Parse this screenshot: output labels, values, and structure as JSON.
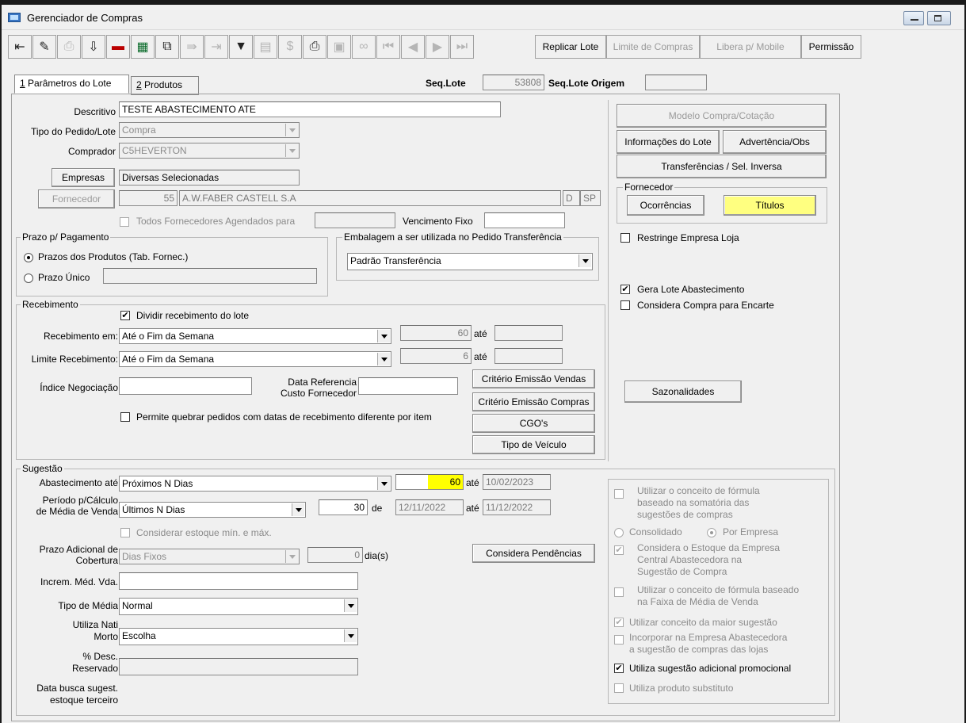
{
  "window": {
    "title": "Gerenciador de Compras"
  },
  "toolbar": {
    "icons": [
      "exit-icon",
      "edit-icon",
      "print-preview-icon",
      "download-icon",
      "delete-icon",
      "spreadsheet-icon",
      "copy-icon",
      "generate-icon",
      "forward-icon",
      "filter-icon",
      "document-icon",
      "cost-icon",
      "print-icon",
      "clipboard-icon",
      "binoculars-icon",
      "first-icon",
      "prev-icon",
      "next-icon",
      "last-icon"
    ],
    "replicar_lote": "Replicar Lote",
    "limite_compras": "Limite de Compras",
    "libera_mobile": "Libera p/ Mobile",
    "permissao": "Permissão"
  },
  "tabs": [
    {
      "num": "1",
      "label": " Parâmetros do Lote"
    },
    {
      "num": "2",
      "label": " Produtos"
    }
  ],
  "header": {
    "seq_lote_label": "Seq.Lote",
    "seq_lote": "53808",
    "seq_lote_origem_label": "Seq.Lote Origem",
    "seq_lote_origem": ""
  },
  "form": {
    "descritivo_label": "Descritivo",
    "descritivo": "TESTE ABASTECIMENTO ATE",
    "tipo_pedido_label": "Tipo do Pedido/Lote",
    "tipo_pedido": "Compra",
    "comprador_label": "Comprador",
    "comprador": "C5HEVERTON",
    "empresas_btn": "Empresas",
    "empresas": "Diversas Selecionadas",
    "fornecedor_btn": "Fornecedor",
    "fornecedor_cod": "55",
    "fornecedor_nome": "A.W.FABER CASTELL S.A",
    "fornecedor_d": "D",
    "fornecedor_uf": "SP",
    "todos_fornecedores": "Todos Fornecedores Agendados para",
    "vencimento_fixo": "Vencimento Fixo",
    "prazo_group": "Prazo p/ Pagamento",
    "prazo_produtos": "Prazos dos Produtos (Tab. Fornec.)",
    "prazo_unico": "Prazo Único",
    "embalagem_group": "Embalagem a ser utilizada no Pedido Transferência",
    "embalagem": "Padrão Transferência",
    "recebimento_group": "Recebimento",
    "dividir_recebimento": "Dividir recebimento do lote",
    "recebimento_em_label": "Recebimento em:",
    "recebimento_em": "Até o Fim da Semana",
    "recebimento_dias": "60",
    "ate": "até",
    "limite_recebimento_label": "Limite Recebimento:",
    "limite_recebimento": "Até o Fim da Semana",
    "limite_dias": "6",
    "indice_negociacao": "Índice Negociação",
    "data_referencia_1": "Data Referencia",
    "data_referencia_2": "Custo Fornecedor",
    "permite_quebrar": "Permite quebrar pedidos com datas de recebimento diferente por item",
    "criterio_vendas": "Critério Emissão Vendas",
    "criterio_compras": "Critério Emissão Compras",
    "cgos": "CGO's",
    "tipo_veiculo": "Tipo de Veículo",
    "sugestao_group": "Sugestão",
    "abastecimento_label": "Abastecimento até",
    "abastecimento": "Próximos N Dias",
    "abastecimento_dias": "60",
    "abastecimento_data": "10/02/2023",
    "periodo_label_1": "Período p/Cálculo",
    "periodo_label_2": "de Média de Venda",
    "periodo": "Últimos N Dias",
    "periodo_dias": "30",
    "de": "de",
    "periodo_de": "12/11/2022",
    "periodo_ate": "11/12/2022",
    "considerar_estoque": "Considerar estoque mín. e máx.",
    "prazo_adicional_1": "Prazo Adicional de",
    "prazo_adicional_2": "Cobertura",
    "prazo_adicional": "Dias Fixos",
    "prazo_dias": "0",
    "dias": "dia(s)",
    "considera_pendencias": "Considera Pendências",
    "increm_label": "Increm. Méd. Vda.",
    "tipo_media_label": "Tipo de Média",
    "tipo_media": "Normal",
    "nati_morto_1": "Utiliza Nati",
    "nati_morto_2": "Morto",
    "nati_morto": "Escolha",
    "desc_reservado_1": "% Desc.",
    "desc_reservado_2": "Reservado",
    "data_busca_1": "Data busca sugest.",
    "data_busca_2": "estoque terceiro"
  },
  "right": {
    "modelo_compra": "Modelo Compra/Cotação",
    "informacoes_lote": "Informações do Lote",
    "advertencia": "Advertência/Obs",
    "transferencias": "Transferências / Sel. Inversa",
    "fornecedor_group": "Fornecedor",
    "ocorrencias": "Ocorrências",
    "titulos": "Títulos",
    "restringe_empresa": "Restringe Empresa Loja",
    "gera_lote": "Gera Lote Abastecimento",
    "considera_encarte": "Considera Compra para Encarte",
    "sazonalidades": "Sazonalidades",
    "formula_somatoria_1": "Utilizar o conceito de fórmula",
    "formula_somatoria_2": "baseado na somatória das",
    "formula_somatoria_3": "sugestões de compras",
    "consolidado": "Consolidado",
    "por_empresa": "Por Empresa",
    "estoque_central_1": "Considera o Estoque da Empresa",
    "estoque_central_2": "Central Abastecedora na",
    "estoque_central_3": "Sugestão de Compra",
    "faixa_media_1": "Utilizar o conceito de fórmula baseado",
    "faixa_media_2": "na Faixa de Média de Venda",
    "maior_sugestao": "Utilizar conceito da maior sugestão",
    "incorporar_1": "Incorporar na Empresa Abastecedora",
    "incorporar_2": "a sugestão de compras das lojas",
    "sugestao_promocional": "Utiliza sugestão adicional promocional",
    "produto_substituto": "Utiliza produto substituto"
  },
  "colors": {
    "highlight": "#ffff00",
    "titulos_bg": "#ffff80"
  }
}
